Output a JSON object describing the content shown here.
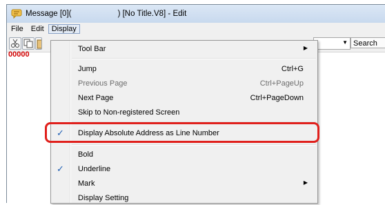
{
  "window": {
    "title": "Message [0](                     ) [No Title.V8] - Edit",
    "icon": "message-icon"
  },
  "menubar": {
    "items": [
      {
        "label": "File"
      },
      {
        "label": "Edit"
      },
      {
        "label": "Display"
      }
    ]
  },
  "toolbar": {
    "icons": [
      "cut-icon",
      "copy-icon",
      "paste-icon"
    ],
    "combo_arrow": "▼",
    "search_label": "Search"
  },
  "editor": {
    "line_number": "00000"
  },
  "display_menu": {
    "items": [
      {
        "label": "Tool Bar",
        "shortcut": "",
        "submenu": true,
        "checked": false,
        "disabled": false
      },
      {
        "label": "Jump",
        "shortcut": "Ctrl+G",
        "submenu": false,
        "checked": false,
        "disabled": false
      },
      {
        "label": "Previous Page",
        "shortcut": "Ctrl+PageUp",
        "submenu": false,
        "checked": false,
        "disabled": true
      },
      {
        "label": "Next Page",
        "shortcut": "Ctrl+PageDown",
        "submenu": false,
        "checked": false,
        "disabled": false
      },
      {
        "label": "Skip to Non-registered Screen",
        "shortcut": "",
        "submenu": false,
        "checked": false,
        "disabled": false
      },
      {
        "label": "Display Absolute Address as Line Number",
        "shortcut": "",
        "submenu": false,
        "checked": true,
        "disabled": false
      },
      {
        "label": "Bold",
        "shortcut": "",
        "submenu": false,
        "checked": false,
        "disabled": false
      },
      {
        "label": "Underline",
        "shortcut": "",
        "submenu": false,
        "checked": true,
        "disabled": false
      },
      {
        "label": "Mark",
        "shortcut": "",
        "submenu": true,
        "checked": false,
        "disabled": false
      },
      {
        "label": "Display Setting",
        "shortcut": "",
        "submenu": false,
        "checked": false,
        "disabled": false
      }
    ],
    "check_glyph": "✓",
    "submenu_glyph": "▶"
  },
  "colors": {
    "highlight": "#e0201c",
    "line_number": "#d00000",
    "check": "#1f5fb4"
  }
}
